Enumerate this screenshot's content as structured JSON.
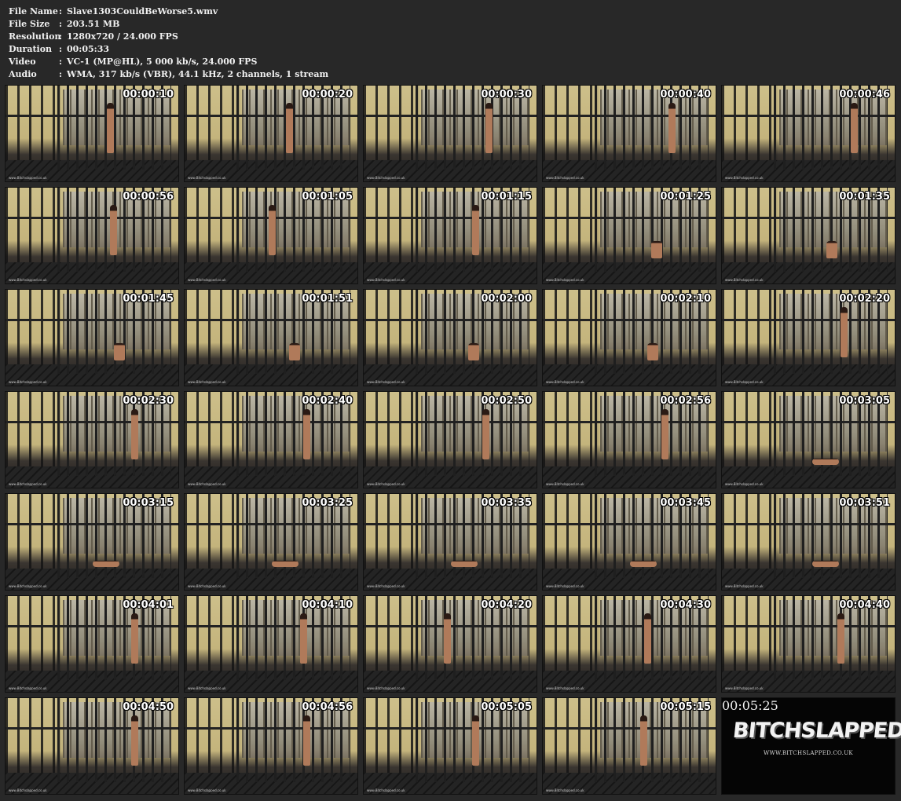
{
  "info": [
    {
      "label": "File Name",
      "sep": ":",
      "value": "Slave1303CouldBeWorse5.wmv"
    },
    {
      "label": "File Size",
      "sep": ":",
      "value": "203.51 MB"
    },
    {
      "label": "Resolution",
      "sep": ":",
      "value": "1280x720 / 24.000 FPS"
    },
    {
      "label": "Duration",
      "sep": ":",
      "value": "00:05:33"
    },
    {
      "label": "Video",
      "sep": ":",
      "value": "VC-1 (MP@HL), 5 000 kb/s, 24.000 FPS"
    },
    {
      "label": "Audio",
      "sep": ":",
      "value": "WMA, 317 kb/s (VBR), 44.1 kHz, 2 channels, 1 stream"
    }
  ],
  "thumbnails": [
    {
      "time": "00:00:10",
      "pose": "standing",
      "pos": 0.58
    },
    {
      "time": "00:00:20",
      "pose": "standing",
      "pos": 0.58
    },
    {
      "time": "00:00:30",
      "pose": "standing",
      "pos": 0.7
    },
    {
      "time": "00:00:40",
      "pose": "standing",
      "pos": 0.72
    },
    {
      "time": "00:00:46",
      "pose": "standing",
      "pos": 0.74
    },
    {
      "time": "00:00:56",
      "pose": "standing",
      "pos": 0.6
    },
    {
      "time": "00:01:05",
      "pose": "standing",
      "pos": 0.48
    },
    {
      "time": "00:01:15",
      "pose": "standing",
      "pos": 0.62
    },
    {
      "time": "00:01:25",
      "pose": "seated",
      "pos": 0.62
    },
    {
      "time": "00:01:35",
      "pose": "seated",
      "pos": 0.6
    },
    {
      "time": "00:01:45",
      "pose": "seated",
      "pos": 0.62
    },
    {
      "time": "00:01:51",
      "pose": "seated",
      "pos": 0.6
    },
    {
      "time": "00:02:00",
      "pose": "seated",
      "pos": 0.6
    },
    {
      "time": "00:02:10",
      "pose": "seated",
      "pos": 0.6
    },
    {
      "time": "00:02:20",
      "pose": "standing",
      "pos": 0.68
    },
    {
      "time": "00:02:30",
      "pose": "standing",
      "pos": 0.72
    },
    {
      "time": "00:02:40",
      "pose": "standing",
      "pos": 0.68
    },
    {
      "time": "00:02:50",
      "pose": "standing",
      "pos": 0.68
    },
    {
      "time": "00:02:56",
      "pose": "standing",
      "pos": 0.68
    },
    {
      "time": "00:03:05",
      "pose": "lying",
      "pos": 0.52
    },
    {
      "time": "00:03:15",
      "pose": "lying",
      "pos": 0.5
    },
    {
      "time": "00:03:25",
      "pose": "lying",
      "pos": 0.5
    },
    {
      "time": "00:03:35",
      "pose": "lying",
      "pos": 0.5
    },
    {
      "time": "00:03:45",
      "pose": "lying",
      "pos": 0.5
    },
    {
      "time": "00:03:51",
      "pose": "lying",
      "pos": 0.52
    },
    {
      "time": "00:04:01",
      "pose": "standing",
      "pos": 0.72
    },
    {
      "time": "00:04:10",
      "pose": "standing",
      "pos": 0.66
    },
    {
      "time": "00:04:20",
      "pose": "standing",
      "pos": 0.46
    },
    {
      "time": "00:04:30",
      "pose": "standing",
      "pos": 0.58
    },
    {
      "time": "00:04:40",
      "pose": "standing",
      "pos": 0.66
    },
    {
      "time": "00:04:50",
      "pose": "standing",
      "pos": 0.72
    },
    {
      "time": "00:04:56",
      "pose": "standing",
      "pos": 0.68
    },
    {
      "time": "00:05:05",
      "pose": "standing",
      "pos": 0.62
    },
    {
      "time": "00:05:15",
      "pose": "standing",
      "pos": 0.56
    }
  ],
  "watermark": "www.Bitchslapped.co.uk",
  "logo": {
    "time": "00:05:25",
    "brand": "BITCHSLAPPED",
    "url": "WWW.BITCHSLAPPED.CO.UK"
  }
}
